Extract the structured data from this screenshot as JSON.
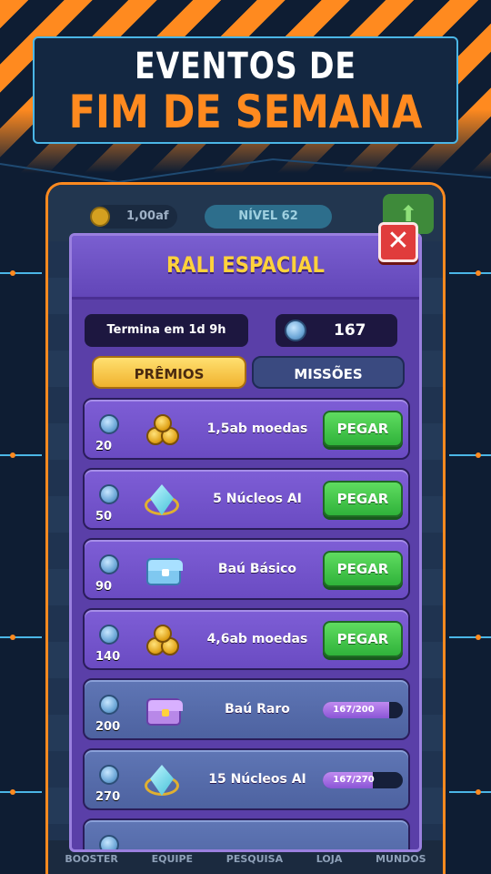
{
  "banner": {
    "line1": "EVENTOS DE",
    "line2": "FIM DE SEMANA"
  },
  "topbar": {
    "coins": "1,00af",
    "level": "NÍVEL 62"
  },
  "modal": {
    "title": "RALI ESPACIAL",
    "ends_in": "Termina em 1d 9h",
    "tokens": "167",
    "tabs": {
      "prizes": "PRÊMIOS",
      "missions": "MISSÕES"
    },
    "items": [
      {
        "cost": "20",
        "label": "1,5ab moedas",
        "icon": "coins-icon",
        "action": "PEGAR"
      },
      {
        "cost": "50",
        "label": "5 Núcleos AI",
        "icon": "gem-icon",
        "action": "PEGAR"
      },
      {
        "cost": "90",
        "label": "Baú Básico",
        "icon": "basic-chest-icon",
        "action": "PEGAR"
      },
      {
        "cost": "140",
        "label": "4,6ab moedas",
        "icon": "coins-icon",
        "action": "PEGAR"
      },
      {
        "cost": "200",
        "label": "Baú Raro",
        "icon": "rare-chest-icon",
        "progress": "167/200",
        "progress_value": 0.835
      },
      {
        "cost": "270",
        "label": "15 Núcleos AI",
        "icon": "gem-icon",
        "progress": "167/270",
        "progress_value": 0.62
      }
    ]
  },
  "bottom_nav": [
    "BOOSTER",
    "EQUIPE",
    "PESQUISA",
    "LOJA",
    "MUNDOS"
  ],
  "colors": {
    "accent": "#ff8a1f",
    "modal": "#5a3fa8",
    "title": "#ffd23c",
    "green": "#2fb23a"
  }
}
